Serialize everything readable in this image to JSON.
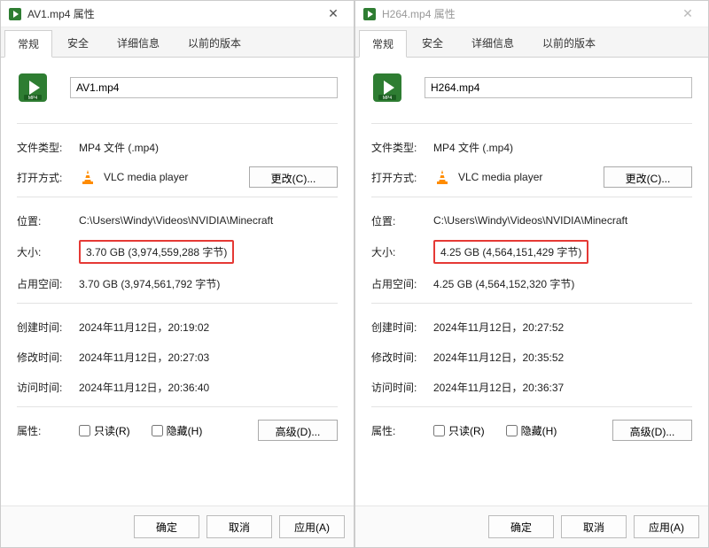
{
  "tabs": [
    "常规",
    "安全",
    "详细信息",
    "以前的版本"
  ],
  "labels": {
    "fileType": "文件类型:",
    "openWith": "打开方式:",
    "location": "位置:",
    "size": "大小:",
    "sizeOnDisk": "占用空间:",
    "created": "创建时间:",
    "modified": "修改时间:",
    "accessed": "访问时间:",
    "attributes": "属性:"
  },
  "common": {
    "fileTypeValue": "MP4 文件 (.mp4)",
    "openWithValue": "VLC media player",
    "locationValue": "C:\\Users\\Windy\\Videos\\NVIDIA\\Minecraft",
    "changeBtn": "更改(C)...",
    "readonly": "只读(R)",
    "hidden": "隐藏(H)",
    "advancedBtn": "高级(D)..."
  },
  "buttons": {
    "ok": "确定",
    "cancel": "取消",
    "apply": "应用(A)"
  },
  "left": {
    "winTitle": "AV1.mp4 属性",
    "filename": "AV1.mp4",
    "size": "3.70 GB (3,974,559,288 字节)",
    "sizeOnDisk": "3.70 GB (3,974,561,792 字节)",
    "created": "2024年11月12日，20:19:02",
    "modified": "2024年11月12日，20:27:03",
    "accessed": "2024年11月12日，20:36:40"
  },
  "right": {
    "winTitle": "H264.mp4 属性",
    "filename": "H264.mp4",
    "size": "4.25 GB (4,564,151,429 字节)",
    "sizeOnDisk": "4.25 GB (4,564,152,320 字节)",
    "created": "2024年11月12日，20:27:52",
    "modified": "2024年11月12日，20:35:52",
    "accessed": "2024年11月12日，20:36:37"
  }
}
